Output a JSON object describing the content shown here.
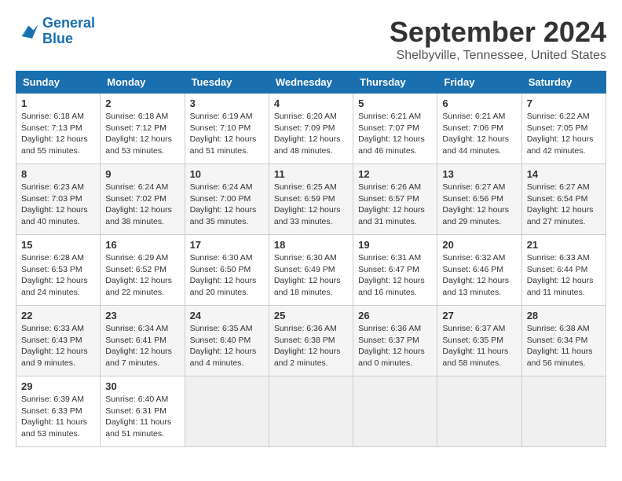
{
  "header": {
    "logo_line1": "General",
    "logo_line2": "Blue",
    "month_title": "September 2024",
    "location": "Shelbyville, Tennessee, United States"
  },
  "calendar": {
    "days_of_week": [
      "Sunday",
      "Monday",
      "Tuesday",
      "Wednesday",
      "Thursday",
      "Friday",
      "Saturday"
    ],
    "weeks": [
      [
        {
          "day": "1",
          "sunrise": "Sunrise: 6:18 AM",
          "sunset": "Sunset: 7:13 PM",
          "daylight": "Daylight: 12 hours and 55 minutes."
        },
        {
          "day": "2",
          "sunrise": "Sunrise: 6:18 AM",
          "sunset": "Sunset: 7:12 PM",
          "daylight": "Daylight: 12 hours and 53 minutes."
        },
        {
          "day": "3",
          "sunrise": "Sunrise: 6:19 AM",
          "sunset": "Sunset: 7:10 PM",
          "daylight": "Daylight: 12 hours and 51 minutes."
        },
        {
          "day": "4",
          "sunrise": "Sunrise: 6:20 AM",
          "sunset": "Sunset: 7:09 PM",
          "daylight": "Daylight: 12 hours and 48 minutes."
        },
        {
          "day": "5",
          "sunrise": "Sunrise: 6:21 AM",
          "sunset": "Sunset: 7:07 PM",
          "daylight": "Daylight: 12 hours and 46 minutes."
        },
        {
          "day": "6",
          "sunrise": "Sunrise: 6:21 AM",
          "sunset": "Sunset: 7:06 PM",
          "daylight": "Daylight: 12 hours and 44 minutes."
        },
        {
          "day": "7",
          "sunrise": "Sunrise: 6:22 AM",
          "sunset": "Sunset: 7:05 PM",
          "daylight": "Daylight: 12 hours and 42 minutes."
        }
      ],
      [
        {
          "day": "8",
          "sunrise": "Sunrise: 6:23 AM",
          "sunset": "Sunset: 7:03 PM",
          "daylight": "Daylight: 12 hours and 40 minutes."
        },
        {
          "day": "9",
          "sunrise": "Sunrise: 6:24 AM",
          "sunset": "Sunset: 7:02 PM",
          "daylight": "Daylight: 12 hours and 38 minutes."
        },
        {
          "day": "10",
          "sunrise": "Sunrise: 6:24 AM",
          "sunset": "Sunset: 7:00 PM",
          "daylight": "Daylight: 12 hours and 35 minutes."
        },
        {
          "day": "11",
          "sunrise": "Sunrise: 6:25 AM",
          "sunset": "Sunset: 6:59 PM",
          "daylight": "Daylight: 12 hours and 33 minutes."
        },
        {
          "day": "12",
          "sunrise": "Sunrise: 6:26 AM",
          "sunset": "Sunset: 6:57 PM",
          "daylight": "Daylight: 12 hours and 31 minutes."
        },
        {
          "day": "13",
          "sunrise": "Sunrise: 6:27 AM",
          "sunset": "Sunset: 6:56 PM",
          "daylight": "Daylight: 12 hours and 29 minutes."
        },
        {
          "day": "14",
          "sunrise": "Sunrise: 6:27 AM",
          "sunset": "Sunset: 6:54 PM",
          "daylight": "Daylight: 12 hours and 27 minutes."
        }
      ],
      [
        {
          "day": "15",
          "sunrise": "Sunrise: 6:28 AM",
          "sunset": "Sunset: 6:53 PM",
          "daylight": "Daylight: 12 hours and 24 minutes."
        },
        {
          "day": "16",
          "sunrise": "Sunrise: 6:29 AM",
          "sunset": "Sunset: 6:52 PM",
          "daylight": "Daylight: 12 hours and 22 minutes."
        },
        {
          "day": "17",
          "sunrise": "Sunrise: 6:30 AM",
          "sunset": "Sunset: 6:50 PM",
          "daylight": "Daylight: 12 hours and 20 minutes."
        },
        {
          "day": "18",
          "sunrise": "Sunrise: 6:30 AM",
          "sunset": "Sunset: 6:49 PM",
          "daylight": "Daylight: 12 hours and 18 minutes."
        },
        {
          "day": "19",
          "sunrise": "Sunrise: 6:31 AM",
          "sunset": "Sunset: 6:47 PM",
          "daylight": "Daylight: 12 hours and 16 minutes."
        },
        {
          "day": "20",
          "sunrise": "Sunrise: 6:32 AM",
          "sunset": "Sunset: 6:46 PM",
          "daylight": "Daylight: 12 hours and 13 minutes."
        },
        {
          "day": "21",
          "sunrise": "Sunrise: 6:33 AM",
          "sunset": "Sunset: 6:44 PM",
          "daylight": "Daylight: 12 hours and 11 minutes."
        }
      ],
      [
        {
          "day": "22",
          "sunrise": "Sunrise: 6:33 AM",
          "sunset": "Sunset: 6:43 PM",
          "daylight": "Daylight: 12 hours and 9 minutes."
        },
        {
          "day": "23",
          "sunrise": "Sunrise: 6:34 AM",
          "sunset": "Sunset: 6:41 PM",
          "daylight": "Daylight: 12 hours and 7 minutes."
        },
        {
          "day": "24",
          "sunrise": "Sunrise: 6:35 AM",
          "sunset": "Sunset: 6:40 PM",
          "daylight": "Daylight: 12 hours and 4 minutes."
        },
        {
          "day": "25",
          "sunrise": "Sunrise: 6:36 AM",
          "sunset": "Sunset: 6:38 PM",
          "daylight": "Daylight: 12 hours and 2 minutes."
        },
        {
          "day": "26",
          "sunrise": "Sunrise: 6:36 AM",
          "sunset": "Sunset: 6:37 PM",
          "daylight": "Daylight: 12 hours and 0 minutes."
        },
        {
          "day": "27",
          "sunrise": "Sunrise: 6:37 AM",
          "sunset": "Sunset: 6:35 PM",
          "daylight": "Daylight: 11 hours and 58 minutes."
        },
        {
          "day": "28",
          "sunrise": "Sunrise: 6:38 AM",
          "sunset": "Sunset: 6:34 PM",
          "daylight": "Daylight: 11 hours and 56 minutes."
        }
      ],
      [
        {
          "day": "29",
          "sunrise": "Sunrise: 6:39 AM",
          "sunset": "Sunset: 6:33 PM",
          "daylight": "Daylight: 11 hours and 53 minutes."
        },
        {
          "day": "30",
          "sunrise": "Sunrise: 6:40 AM",
          "sunset": "Sunset: 6:31 PM",
          "daylight": "Daylight: 11 hours and 51 minutes."
        },
        {
          "day": "",
          "sunrise": "",
          "sunset": "",
          "daylight": ""
        },
        {
          "day": "",
          "sunrise": "",
          "sunset": "",
          "daylight": ""
        },
        {
          "day": "",
          "sunrise": "",
          "sunset": "",
          "daylight": ""
        },
        {
          "day": "",
          "sunrise": "",
          "sunset": "",
          "daylight": ""
        },
        {
          "day": "",
          "sunrise": "",
          "sunset": "",
          "daylight": ""
        }
      ]
    ]
  }
}
